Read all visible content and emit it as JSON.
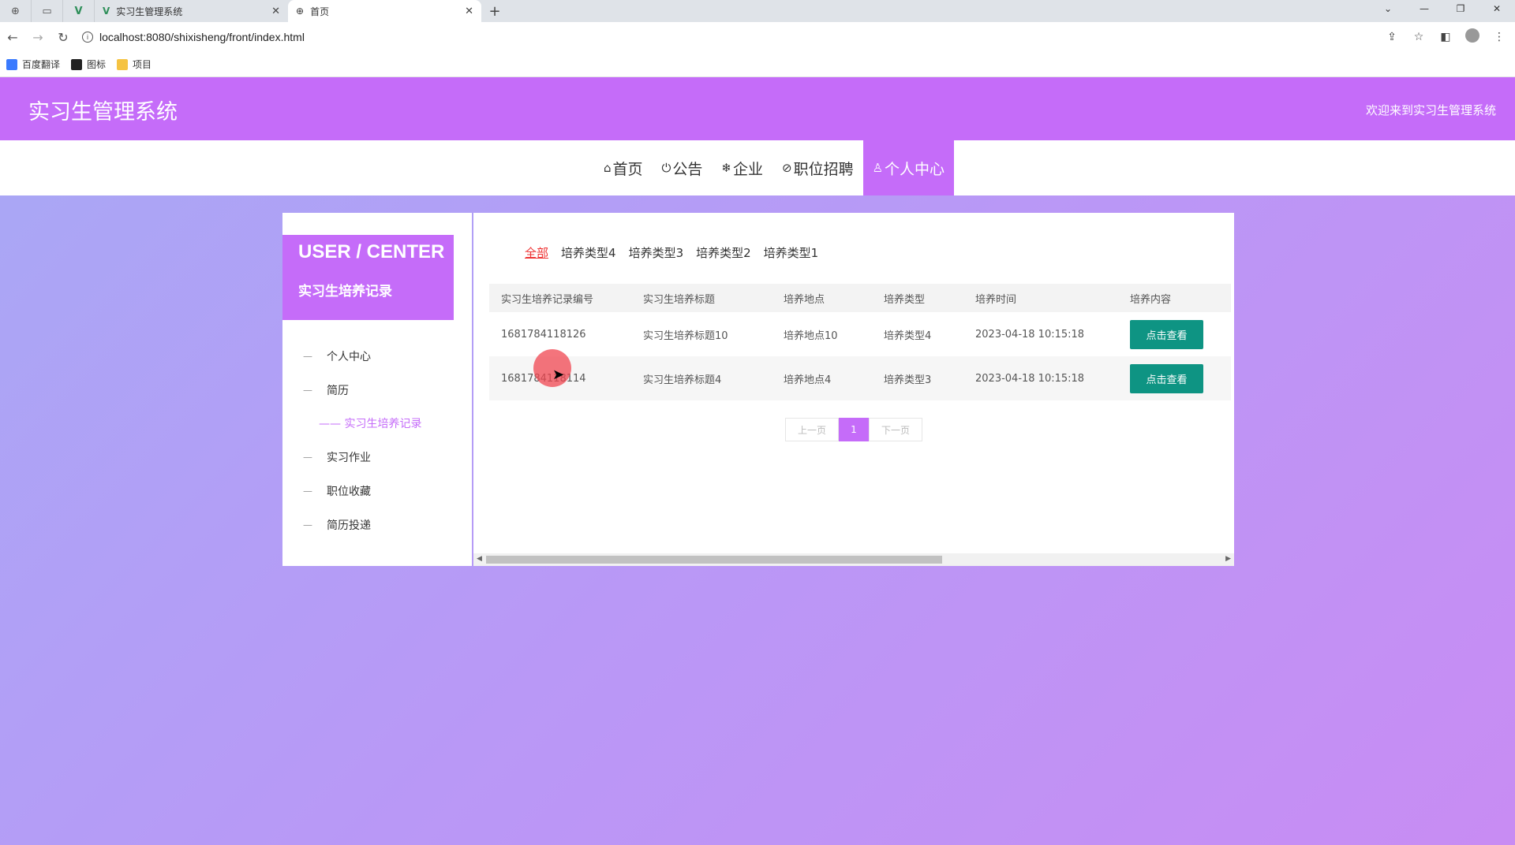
{
  "browser": {
    "tabs": [
      {
        "title": "实习生管理系统",
        "close": "✕"
      },
      {
        "title": "首页",
        "close": "✕"
      }
    ],
    "new_tab": "+",
    "url": "localhost:8080/shixisheng/front/index.html",
    "bookmarks": [
      {
        "label": "百度翻译",
        "color": "#3a7afe"
      },
      {
        "label": "图标",
        "color": "#222222"
      },
      {
        "label": "项目",
        "color": "#f5c342"
      }
    ]
  },
  "site": {
    "title": "实习生管理系统",
    "welcome": "欢迎来到实习生管理系统",
    "accent": "#c56cf9"
  },
  "nav": [
    {
      "icon": "⌂",
      "label": "首页"
    },
    {
      "icon": "⏻",
      "label": "公告"
    },
    {
      "icon": "❄",
      "label": "企业"
    },
    {
      "icon": "⊘",
      "label": "职位招聘"
    },
    {
      "icon": "♙",
      "label": "个人中心"
    }
  ],
  "sidebar": {
    "heading": "USER / CENTER",
    "subheading": "实习生培养记录",
    "items": [
      {
        "label": "个人中心"
      },
      {
        "label": "简历"
      },
      {
        "label": "实习作业"
      },
      {
        "label": "职位收藏"
      },
      {
        "label": "简历投递"
      }
    ],
    "active_sub": "—— 实习生培养记录"
  },
  "filters": [
    "全部",
    "培养类型4",
    "培养类型3",
    "培养类型2",
    "培养类型1"
  ],
  "table": {
    "headers": [
      "实习生培养记录编号",
      "实习生培养标题",
      "培养地点",
      "培养类型",
      "培养时间",
      "培养内容"
    ],
    "rows": [
      {
        "id": "1681784118126",
        "title": "实习生培养标题10",
        "place": "培养地点10",
        "type": "培养类型4",
        "time": "2023-04-18 10:15:18",
        "action": "点击查看"
      },
      {
        "id": "1681784118114",
        "title": "实习生培养标题4",
        "place": "培养地点4",
        "type": "培养类型3",
        "time": "2023-04-18 10:15:18",
        "action": "点击查看"
      }
    ]
  },
  "pager": {
    "prev": "上一页",
    "page": "1",
    "next": "下一页"
  }
}
